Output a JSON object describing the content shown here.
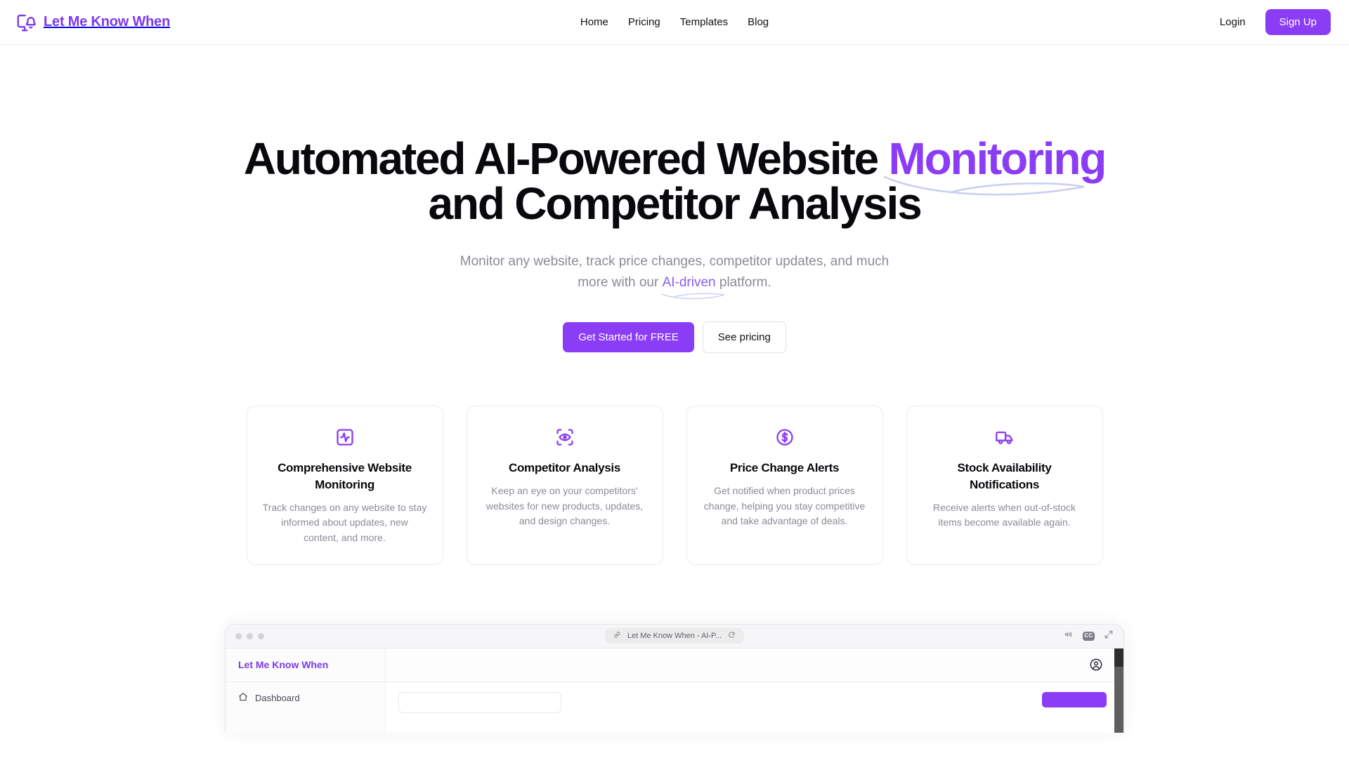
{
  "header": {
    "brand": "Let Me Know When",
    "brand_icon": "monitor-bell-icon",
    "nav": [
      {
        "label": "Home",
        "name": "nav-link-home"
      },
      {
        "label": "Pricing",
        "name": "nav-link-pricing"
      },
      {
        "label": "Templates",
        "name": "nav-link-templates"
      },
      {
        "label": "Blog",
        "name": "nav-link-blog"
      }
    ],
    "login_label": "Login",
    "signup_label": "Sign Up"
  },
  "hero": {
    "headline_part1": "Automated AI-Powered Website ",
    "headline_accent": "Monitoring",
    "headline_part2": " and Competitor Analysis",
    "subhead_part1": "Monitor any website, track price changes, competitor updates, and much more with our ",
    "subhead_accent": "AI-driven",
    "subhead_part2": " platform.",
    "cta_primary": "Get Started for FREE",
    "cta_secondary": "See pricing"
  },
  "cards": [
    {
      "icon": "activity-square-icon",
      "title": "Comprehensive Website Monitoring",
      "desc": "Track changes on any website to stay informed about updates, new content, and more."
    },
    {
      "icon": "scan-eye-icon",
      "title": "Competitor Analysis",
      "desc": "Keep an eye on your competitors' websites for new products, updates, and design changes."
    },
    {
      "icon": "circle-dollar-sign-icon",
      "title": "Price Change Alerts",
      "desc": "Get notified when product prices change, helping you stay competitive and take advantage of deals."
    },
    {
      "icon": "truck-icon",
      "title": "Stock Availability Notifications",
      "desc": "Receive alerts when out-of-stock items become available again."
    }
  ],
  "mockup": {
    "url_title": "Let Me Know When - AI-P...",
    "link_icon": "link-icon",
    "reload_icon": "reload-icon",
    "volume_icon": "volume-icon",
    "cc_label": "CC",
    "expand_icon": "expand-icon",
    "sidebar_title": "Let Me Know When",
    "sidebar_items": [
      {
        "label": "Dashboard",
        "icon": "home-icon"
      }
    ],
    "avatar_icon": "user-circle-icon"
  },
  "colors": {
    "accent": "#8b3df5",
    "brand": "#7c3aed",
    "swoosh": "#c7cdf0",
    "muted_text": "#8b8b96",
    "heading": "#09090d"
  }
}
